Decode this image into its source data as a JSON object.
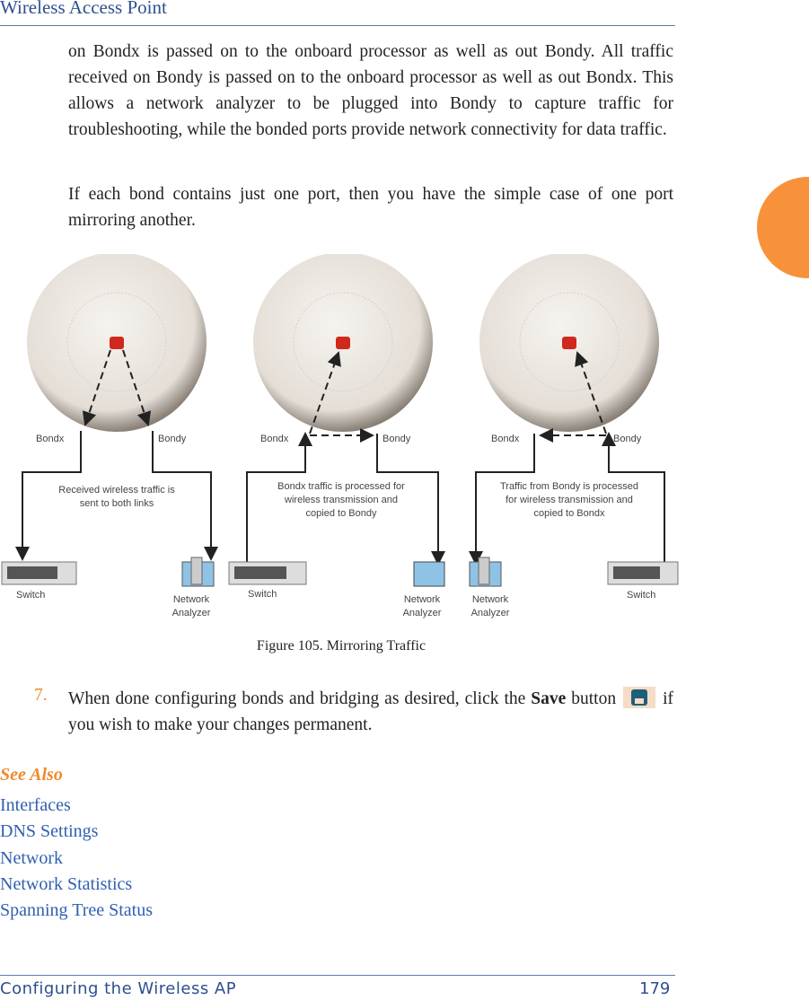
{
  "header": {
    "title": "Wireless Access Point"
  },
  "body": {
    "p1": "on Bondx is passed on to the onboard processor as well as out Bondy. All traffic received on Bondy is passed on to the onboard processor as well as out Bondx. This allows a network analyzer to be plugged into Bondy to capture traffic for troubleshooting, while the bonded ports provide network connectivity for data traffic.",
    "p2": "If each bond contains just one port, then you have the simple case of one port mirroring another."
  },
  "figure": {
    "caption": "Figure 105. Mirroring Traffic",
    "panels": [
      {
        "bondx": "Bondx",
        "bondy": "Bondy",
        "desc": [
          "Received wireless traffic is",
          "sent to both links"
        ],
        "left_device": "Switch",
        "right_device": [
          "Network",
          "Analyzer"
        ]
      },
      {
        "bondx": "Bondx",
        "bondy": "Bondy",
        "desc": [
          "Bondx traffic is processed for",
          "wireless transmission and",
          "copied to Bondy"
        ],
        "left_device": "Switch",
        "right_device": [
          "Network",
          "Analyzer"
        ]
      },
      {
        "bondx": "Bondx",
        "bondy": "Bondy",
        "desc": [
          "Traffic from Bondy is processed",
          "for wireless transmission and",
          "copied to Bondx"
        ],
        "left_device": [
          "Network",
          "Analyzer"
        ],
        "right_device": "Switch"
      }
    ]
  },
  "step": {
    "number": "7.",
    "text_before": "When done configuring bonds and bridging as desired, click the ",
    "bold": "Save",
    "text_middle": " button ",
    "text_after": " if you wish to make your changes permanent.",
    "icon": "save-icon"
  },
  "see_also": {
    "heading": "See Also",
    "links": [
      "Interfaces",
      "DNS Settings",
      "Network",
      "Network Statistics",
      "Spanning Tree Status"
    ]
  },
  "footer": {
    "section": "Configuring the Wireless AP",
    "page": "179"
  },
  "colors": {
    "accent": "#f08a2c",
    "link": "#2f5fb0",
    "header": "#2d4f8e"
  }
}
